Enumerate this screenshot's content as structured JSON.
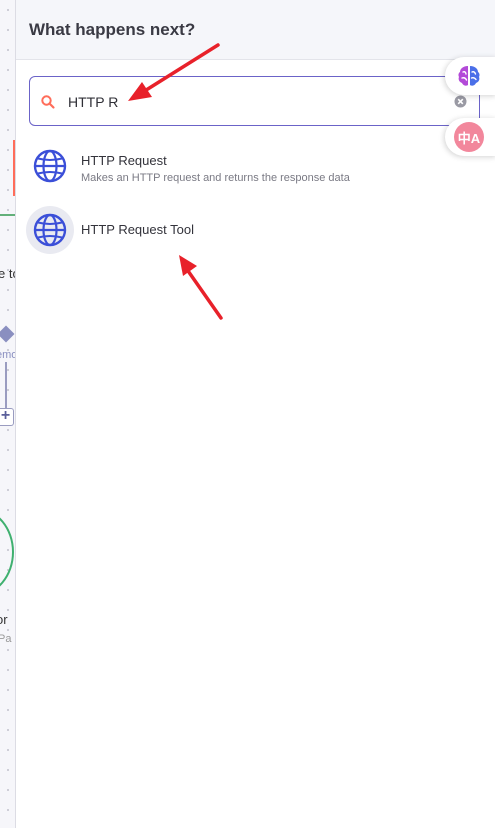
{
  "panel": {
    "title": "What happens next?"
  },
  "search": {
    "value": "HTTP R",
    "placeholder": ""
  },
  "results": [
    {
      "title": "HTTP Request",
      "description": "Makes an HTTP request and returns the response data",
      "icon": "globe-icon"
    },
    {
      "title": "HTTP Request Tool",
      "description": "",
      "icon": "globe-icon"
    }
  ],
  "canvas_clips": {
    "text_1": "e to",
    "text_2": "emo",
    "text_3": "or",
    "text_4": "Pa",
    "plus": "+"
  },
  "extensions": {
    "translate_glyph": "中A"
  },
  "colors": {
    "accent": "#6b63c8",
    "arrow": "#e8212a",
    "icon_blue": "#3b4fd8",
    "orange": "#ff6d5a",
    "green": "#3fb06f"
  }
}
